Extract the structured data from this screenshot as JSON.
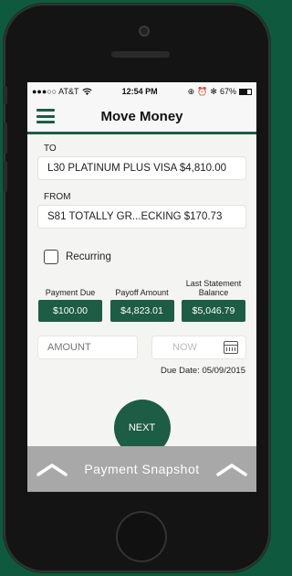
{
  "status": {
    "carrier": "●●●○○ AT&T",
    "time": "12:54 PM",
    "battery": "67%"
  },
  "nav": {
    "title": "Move Money"
  },
  "to": {
    "label": "TO",
    "account": "L30 PLATINUM PLUS VISA $4,810.00"
  },
  "from": {
    "label": "FROM",
    "account": "S81 TOTALLY GR...ECKING $170.73"
  },
  "recurring": {
    "label": "Recurring",
    "checked": false
  },
  "quick_amounts": [
    {
      "label": "Payment Due",
      "value": "$100.00"
    },
    {
      "label": "Payoff Amount",
      "value": "$4,823.01"
    },
    {
      "label": "Last Statement Balance",
      "value": "$5,046.79"
    }
  ],
  "amount": {
    "placeholder": "AMOUNT"
  },
  "date": {
    "value": "NOW"
  },
  "due_date": "Due Date: 05/09/2015",
  "next_label": "NEXT",
  "snapshot": {
    "title": "Payment Snapshot"
  },
  "colors": {
    "accent": "#1d5c45",
    "background": "#0f5a3f",
    "snapshot_bar": "#a8a8a8"
  },
  "icons": [
    "menu-icon",
    "wifi-icon",
    "battery-icon",
    "calendar-icon",
    "chevron-up-icon"
  ]
}
